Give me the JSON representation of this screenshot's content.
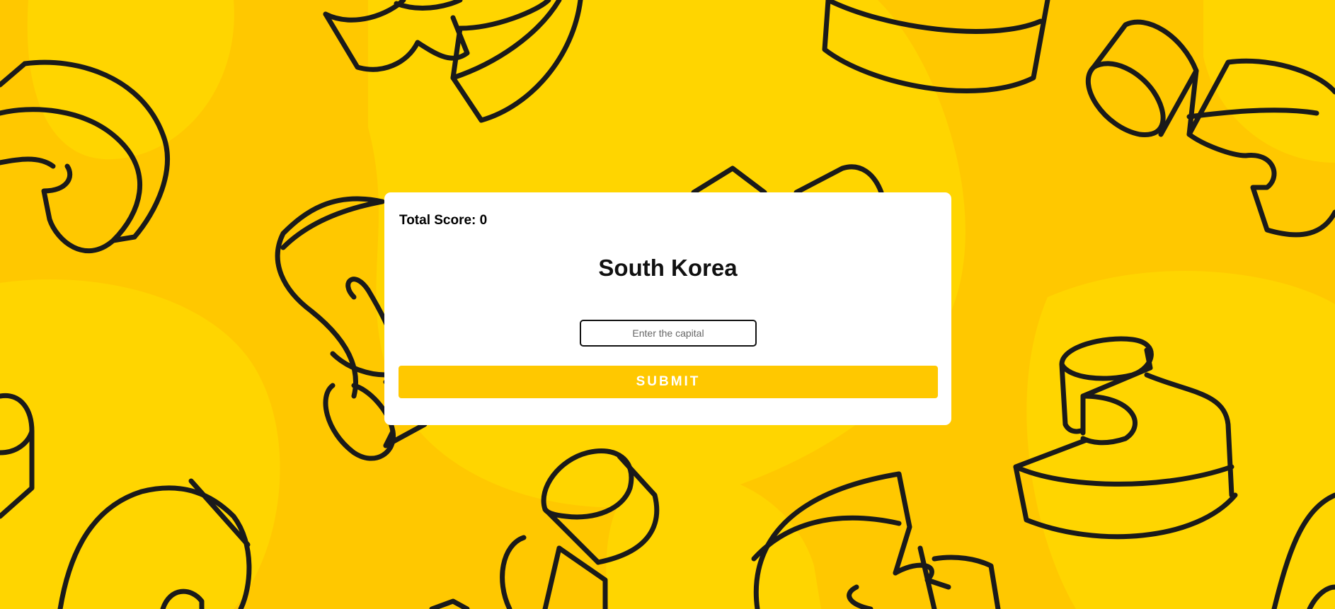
{
  "score": {
    "label": "Total Score: 0"
  },
  "question": {
    "country": "South Korea"
  },
  "answer": {
    "placeholder": "Enter the capital",
    "value": ""
  },
  "actions": {
    "submit_label": "SUBMIT"
  },
  "theme": {
    "background": "#FFC800",
    "blob_light": "#FFD500",
    "card": "#FFFFFF",
    "outline": "#1A1A1A",
    "button": "#FFC800",
    "button_text": "#FFFFFF"
  }
}
